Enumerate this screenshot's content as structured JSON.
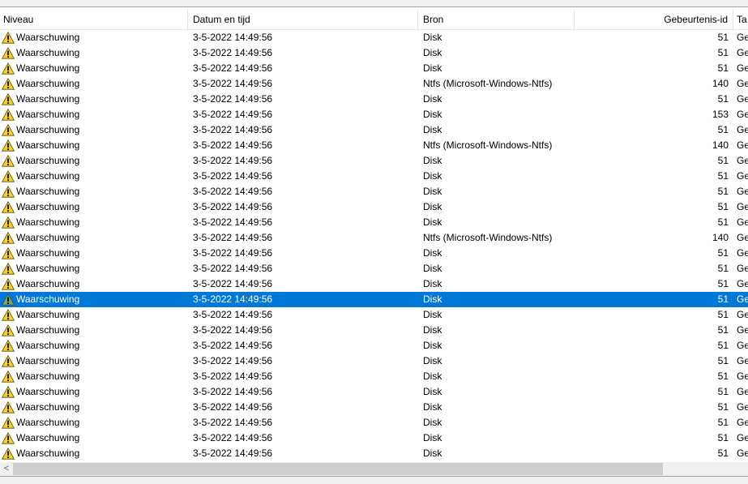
{
  "top_strip_text": "                                                ",
  "columns": {
    "level": "Niveau",
    "datetime": "Datum en tijd",
    "source": "Bron",
    "event_id": "Gebeurtenis-id",
    "task": "Ta"
  },
  "colors": {
    "selection": "#0078d7",
    "warning_icon": "#f7d21c"
  },
  "icons": {
    "warning": "warning-triangle-icon",
    "scroll_left": "chevron-left-icon"
  },
  "selected_index": 17,
  "rows": [
    {
      "level": "Waarschuwing",
      "datetime": "3-5-2022 14:49:56",
      "source": "Disk",
      "event_id": "51",
      "task": "Ge"
    },
    {
      "level": "Waarschuwing",
      "datetime": "3-5-2022 14:49:56",
      "source": "Disk",
      "event_id": "51",
      "task": "Ge"
    },
    {
      "level": "Waarschuwing",
      "datetime": "3-5-2022 14:49:56",
      "source": "Disk",
      "event_id": "51",
      "task": "Ge"
    },
    {
      "level": "Waarschuwing",
      "datetime": "3-5-2022 14:49:56",
      "source": "Ntfs (Microsoft-Windows-Ntfs)",
      "event_id": "140",
      "task": "Ge"
    },
    {
      "level": "Waarschuwing",
      "datetime": "3-5-2022 14:49:56",
      "source": "Disk",
      "event_id": "51",
      "task": "Ge"
    },
    {
      "level": "Waarschuwing",
      "datetime": "3-5-2022 14:49:56",
      "source": "Disk",
      "event_id": "153",
      "task": "Ge"
    },
    {
      "level": "Waarschuwing",
      "datetime": "3-5-2022 14:49:56",
      "source": "Disk",
      "event_id": "51",
      "task": "Ge"
    },
    {
      "level": "Waarschuwing",
      "datetime": "3-5-2022 14:49:56",
      "source": "Ntfs (Microsoft-Windows-Ntfs)",
      "event_id": "140",
      "task": "Ge"
    },
    {
      "level": "Waarschuwing",
      "datetime": "3-5-2022 14:49:56",
      "source": "Disk",
      "event_id": "51",
      "task": "Ge"
    },
    {
      "level": "Waarschuwing",
      "datetime": "3-5-2022 14:49:56",
      "source": "Disk",
      "event_id": "51",
      "task": "Ge"
    },
    {
      "level": "Waarschuwing",
      "datetime": "3-5-2022 14:49:56",
      "source": "Disk",
      "event_id": "51",
      "task": "Ge"
    },
    {
      "level": "Waarschuwing",
      "datetime": "3-5-2022 14:49:56",
      "source": "Disk",
      "event_id": "51",
      "task": "Ge"
    },
    {
      "level": "Waarschuwing",
      "datetime": "3-5-2022 14:49:56",
      "source": "Disk",
      "event_id": "51",
      "task": "Ge"
    },
    {
      "level": "Waarschuwing",
      "datetime": "3-5-2022 14:49:56",
      "source": "Ntfs (Microsoft-Windows-Ntfs)",
      "event_id": "140",
      "task": "Ge"
    },
    {
      "level": "Waarschuwing",
      "datetime": "3-5-2022 14:49:56",
      "source": "Disk",
      "event_id": "51",
      "task": "Ge"
    },
    {
      "level": "Waarschuwing",
      "datetime": "3-5-2022 14:49:56",
      "source": "Disk",
      "event_id": "51",
      "task": "Ge"
    },
    {
      "level": "Waarschuwing",
      "datetime": "3-5-2022 14:49:56",
      "source": "Disk",
      "event_id": "51",
      "task": "Ge"
    },
    {
      "level": "Waarschuwing",
      "datetime": "3-5-2022 14:49:56",
      "source": "Disk",
      "event_id": "51",
      "task": "Ge"
    },
    {
      "level": "Waarschuwing",
      "datetime": "3-5-2022 14:49:56",
      "source": "Disk",
      "event_id": "51",
      "task": "Ge"
    },
    {
      "level": "Waarschuwing",
      "datetime": "3-5-2022 14:49:56",
      "source": "Disk",
      "event_id": "51",
      "task": "Ge"
    },
    {
      "level": "Waarschuwing",
      "datetime": "3-5-2022 14:49:56",
      "source": "Disk",
      "event_id": "51",
      "task": "Ge"
    },
    {
      "level": "Waarschuwing",
      "datetime": "3-5-2022 14:49:56",
      "source": "Disk",
      "event_id": "51",
      "task": "Ge"
    },
    {
      "level": "Waarschuwing",
      "datetime": "3-5-2022 14:49:56",
      "source": "Disk",
      "event_id": "51",
      "task": "Ge"
    },
    {
      "level": "Waarschuwing",
      "datetime": "3-5-2022 14:49:56",
      "source": "Disk",
      "event_id": "51",
      "task": "Ge"
    },
    {
      "level": "Waarschuwing",
      "datetime": "3-5-2022 14:49:56",
      "source": "Disk",
      "event_id": "51",
      "task": "Ge"
    },
    {
      "level": "Waarschuwing",
      "datetime": "3-5-2022 14:49:56",
      "source": "Disk",
      "event_id": "51",
      "task": "Ge"
    },
    {
      "level": "Waarschuwing",
      "datetime": "3-5-2022 14:49:56",
      "source": "Disk",
      "event_id": "51",
      "task": "Ge"
    },
    {
      "level": "Waarschuwing",
      "datetime": "3-5-2022 14:49:56",
      "source": "Disk",
      "event_id": "51",
      "task": "Ge"
    }
  ]
}
